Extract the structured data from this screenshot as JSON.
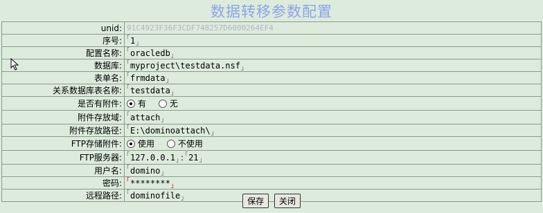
{
  "page": {
    "title": "数据转移参数配置"
  },
  "form": {
    "unid": {
      "label": "unid:",
      "value": "91C4923F36F3CDF748257D6000264EF4"
    },
    "seq": {
      "label": "序号:",
      "value": "1"
    },
    "config_name": {
      "label": "配置名称:",
      "value": "oracledb"
    },
    "database": {
      "label": "数据库:",
      "value": "myproject\\testdata.nsf"
    },
    "form_name": {
      "label": "表单名:",
      "value": "frmdata"
    },
    "relational_table": {
      "label": "关系数据库表名称:",
      "value": "testdata"
    },
    "has_attachment": {
      "label": "是否有附件:",
      "options": [
        "有",
        "无"
      ],
      "selected": "有"
    },
    "attachment_field": {
      "label": "附件存放域:",
      "value": "attach"
    },
    "attachment_path": {
      "label": "附件存放路径:",
      "value": "E:\\dominoattach\\"
    },
    "ftp_store": {
      "label": "FTP存储附件:",
      "options": [
        "使用",
        "不使用"
      ],
      "selected": "使用"
    },
    "ftp_server": {
      "label": "FTP服务器:",
      "host": "127.0.0.1",
      "separator": ":",
      "port": "21"
    },
    "username": {
      "label": "用户名:",
      "value": "domino"
    },
    "password": {
      "label": "密码:",
      "value": "********"
    },
    "remote_path": {
      "label": "远程路径:",
      "value": "dominofile"
    }
  },
  "buttons": {
    "save": "保存",
    "close": "关闭"
  }
}
